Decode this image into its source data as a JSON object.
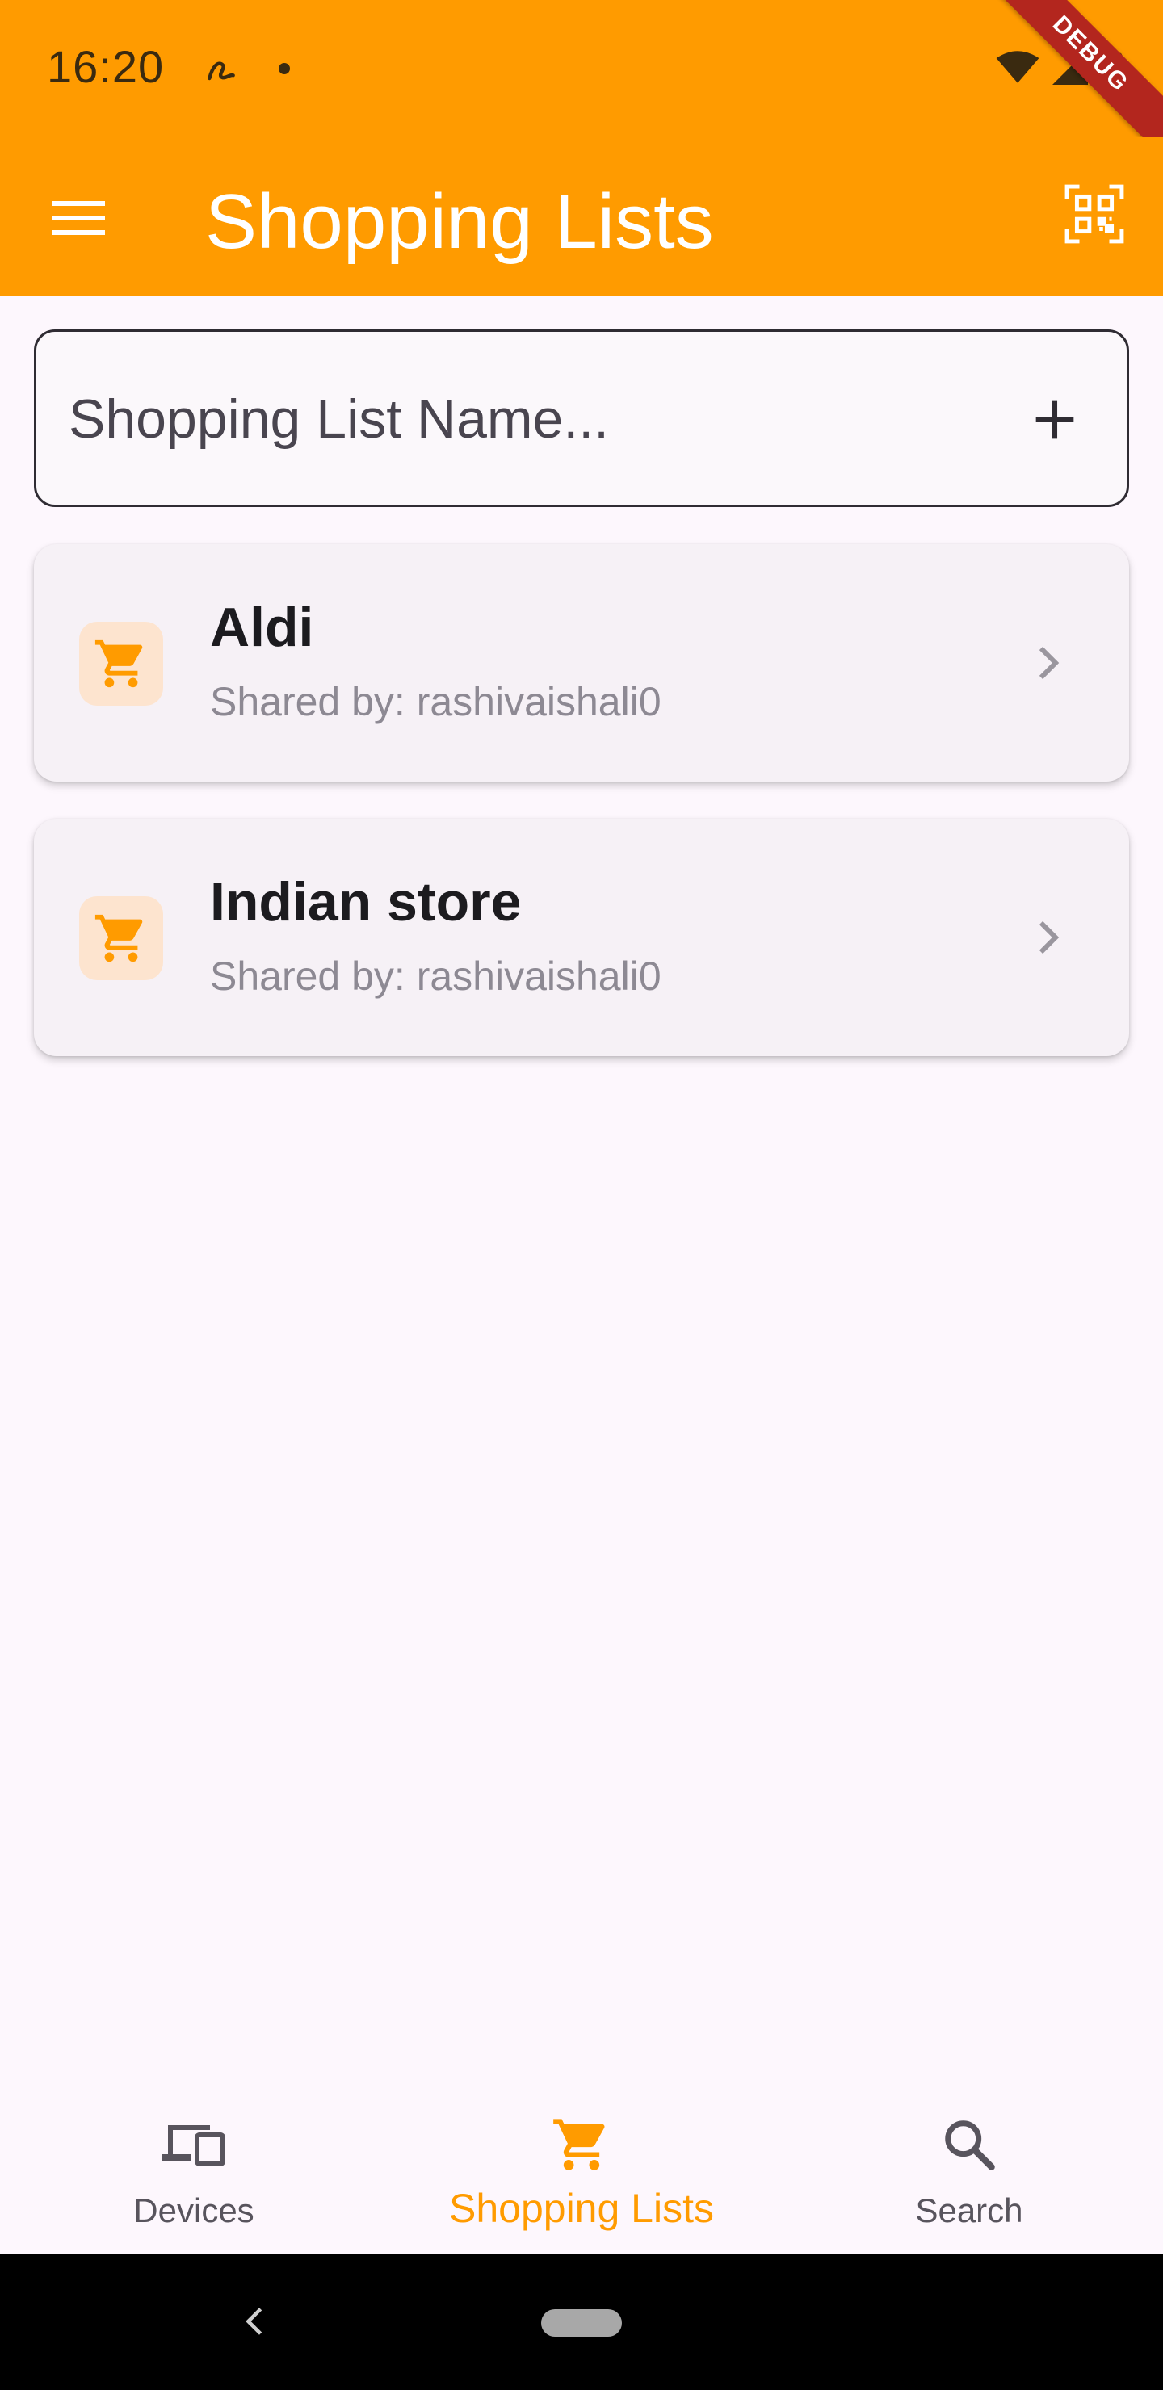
{
  "status_bar": {
    "time": "16:20",
    "debug_label": "DEBUG",
    "background": "#ff9b00"
  },
  "app_bar": {
    "title": "Shopping Lists",
    "menu_icon": "menu-icon",
    "action_icon": "qr-code-scanner-icon"
  },
  "new_list": {
    "placeholder": "Shopping List Name...",
    "value": "",
    "add_icon": "plus-icon"
  },
  "lists": [
    {
      "name": "Aldi",
      "subtitle": "Shared by: rashivaishali0",
      "icon": "cart-icon"
    },
    {
      "name": "Indian store",
      "subtitle": "Shared by: rashivaishali0",
      "icon": "cart-icon"
    }
  ],
  "bottom_nav": {
    "items": [
      {
        "label": "Devices",
        "icon": "devices-icon",
        "selected": false
      },
      {
        "label": "Shopping Lists",
        "icon": "cart-icon",
        "selected": true
      },
      {
        "label": "Search",
        "icon": "search-icon",
        "selected": false
      }
    ]
  },
  "colors": {
    "accent": "#ff9b00",
    "background": "#fdf7fd",
    "card": "#f6f1f6",
    "icon_tile": "#fde4cf"
  }
}
